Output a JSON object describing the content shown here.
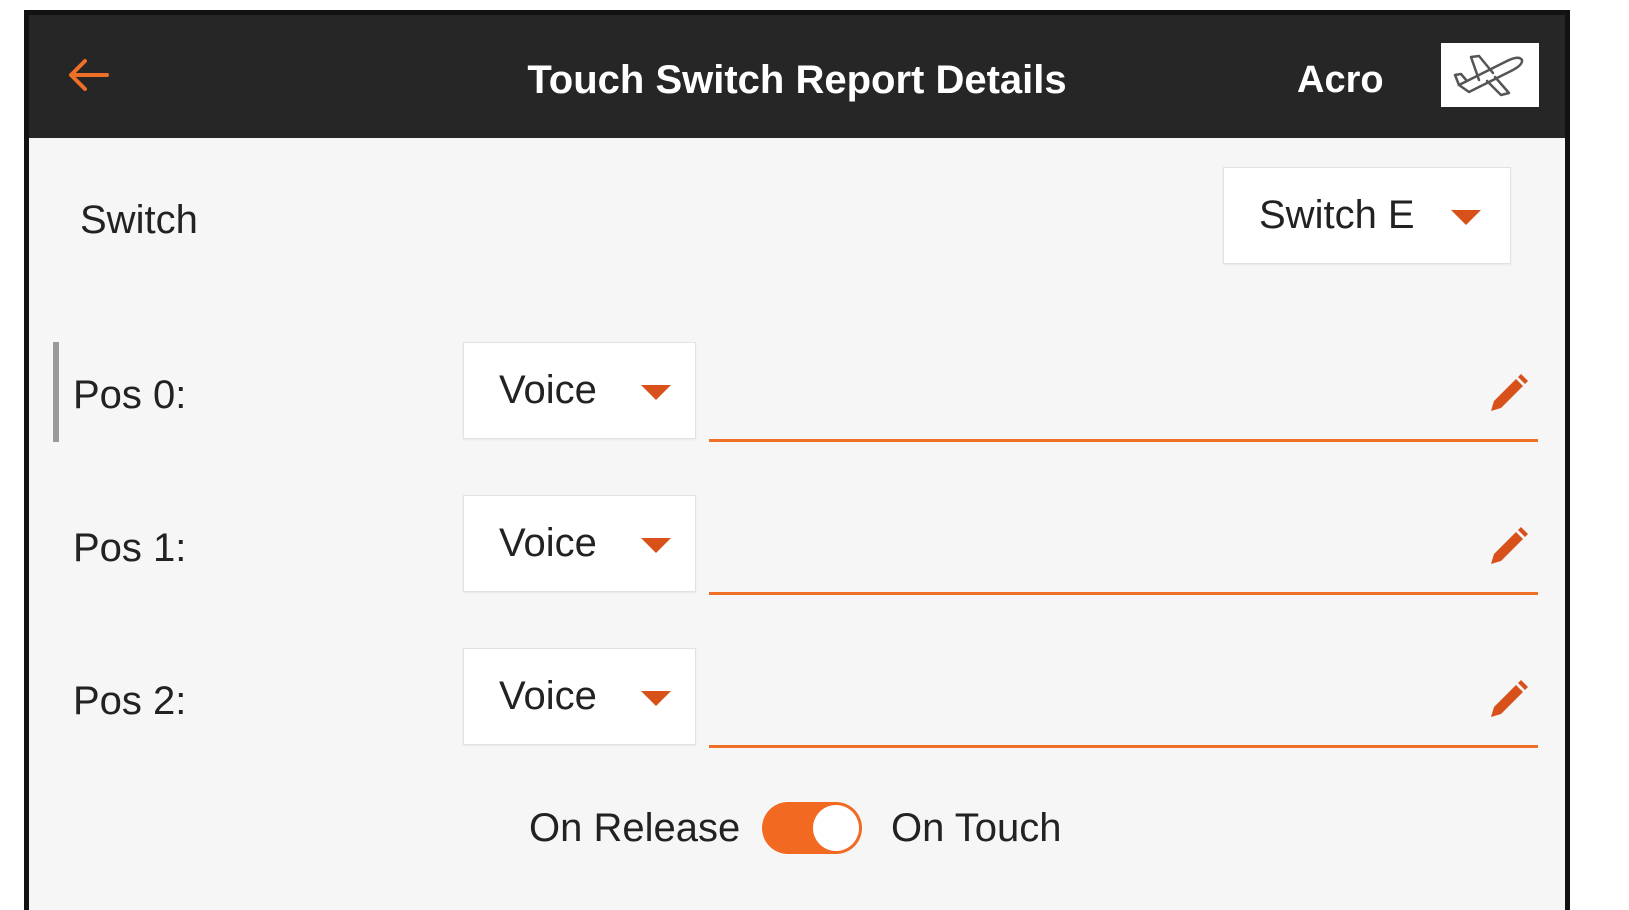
{
  "header": {
    "title": "Touch Switch Report Details",
    "model_name": "Acro",
    "back_icon": "arrow-left-icon",
    "model_icon": "airplane-icon"
  },
  "switch": {
    "label": "Switch",
    "value": "Switch E"
  },
  "positions": [
    {
      "label": "Pos 0:",
      "type": "Voice",
      "text": ""
    },
    {
      "label": "Pos 1:",
      "type": "Voice",
      "text": ""
    },
    {
      "label": "Pos 2:",
      "type": "Voice",
      "text": ""
    }
  ],
  "trigger": {
    "left_label": "On Release",
    "right_label": "On Touch",
    "selected": "On Touch"
  },
  "colors": {
    "accent": "#ee6f25",
    "header_bg": "#262626",
    "page_bg": "#f6f6f6"
  }
}
